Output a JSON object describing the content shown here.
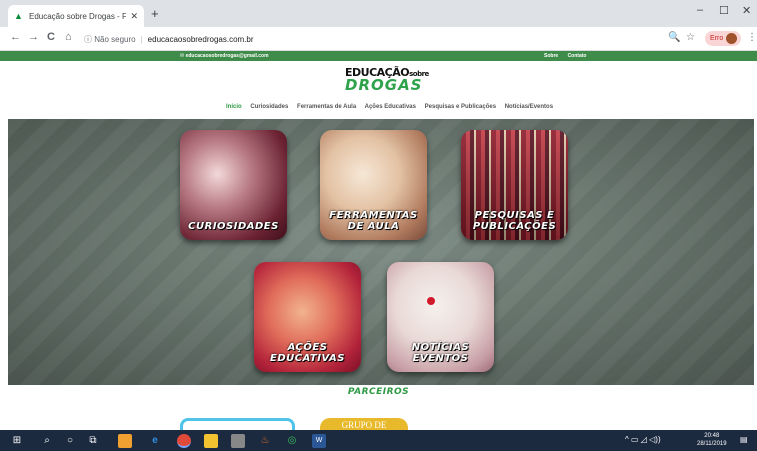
{
  "browser": {
    "tab_title": "Educação sobre Drogas - França",
    "tab_close": "✕",
    "new_tab": "+",
    "minimize": "–",
    "maximize": "☐",
    "close": "✕",
    "back": "←",
    "forward": "→",
    "reload": "C",
    "home": "⌂",
    "security_label": "ⓘ Não seguro",
    "url": "educacaosobredrogas.com.br",
    "zoom_icon": "🔍",
    "bookmark_icon": "☆",
    "profile_label": "Erro",
    "menu": "⋮"
  },
  "site": {
    "top_email": "✉ educacaosobredrogas@gmail.com",
    "top_links": [
      "Sobre",
      "Contato"
    ],
    "logo_line1": "EDUCAÇÃO",
    "logo_line1_small": "sobre",
    "logo_line2": "DROGAS",
    "nav": [
      {
        "label": "Início",
        "active": true
      },
      {
        "label": "Curiosidades",
        "active": false
      },
      {
        "label": "Ferramentas de Aula",
        "active": false
      },
      {
        "label": "Ações Educativas",
        "active": false
      },
      {
        "label": "Pesquisas e Publicações",
        "active": false
      },
      {
        "label": "Notícias/Eventos",
        "active": false
      }
    ],
    "cards": [
      "CURIOSIDADES",
      "FERRAMENTAS DE AULA",
      "PESQUISAS E PUBLICAÇÕES",
      "AÇÕES EDUCATIVAS",
      "NOTÍCIAS EVENTOS"
    ],
    "partners_heading": "PARCEIROS",
    "partner_b_text": "GRUPO DE"
  },
  "taskbar": {
    "start": "⊞",
    "search": "⌕",
    "cortana": "○",
    "taskview": "⧉",
    "tray_icons": "^ ▭ ◿ ◁))",
    "time": "20:48",
    "date": "28/11/2019",
    "notifications": "▤"
  },
  "colors": {
    "brand_green": "#3f8c4a",
    "nav_active": "#2e9a44",
    "taskbar": "#1c2a40"
  }
}
